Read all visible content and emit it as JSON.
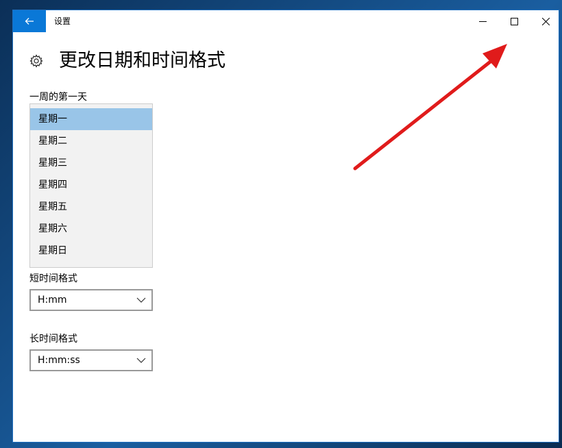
{
  "window": {
    "title": "设置"
  },
  "page": {
    "title": "更改日期和时间格式"
  },
  "first_day": {
    "label": "一周的第一天",
    "options": [
      "星期一",
      "星期二",
      "星期三",
      "星期四",
      "星期五",
      "星期六",
      "星期日"
    ],
    "selected": "星期一"
  },
  "short_time": {
    "label": "短时间格式",
    "value": "H:mm"
  },
  "long_time": {
    "label": "长时间格式",
    "value": "H:mm:ss"
  },
  "colors": {
    "accent": "#0a78d7",
    "selected_item": "#99c5e8",
    "annotation_arrow": "#e01b1b"
  },
  "icons": {
    "back": "back-arrow-icon",
    "minimize": "minimize-icon",
    "maximize": "maximize-icon",
    "close": "close-icon",
    "settings": "gear-icon",
    "dropdown": "chevron-down-icon"
  }
}
